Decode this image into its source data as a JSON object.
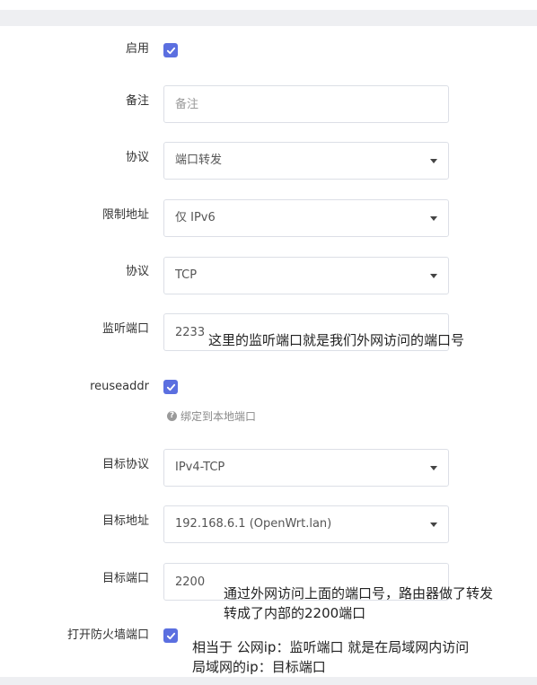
{
  "form": {
    "enable": {
      "label": "启用",
      "checked": true
    },
    "remark": {
      "label": "备注",
      "placeholder": "备注",
      "value": ""
    },
    "protocol": {
      "label": "协议",
      "value": "端口转发"
    },
    "restrict_address": {
      "label": "限制地址",
      "value": "仅 IPv6"
    },
    "protocol2": {
      "label": "协议",
      "value": "TCP"
    },
    "listen_port": {
      "label": "监听端口",
      "value": "2233"
    },
    "reuseaddr": {
      "label": "reuseaddr",
      "checked": true,
      "hint": "绑定到本地端口"
    },
    "target_protocol": {
      "label": "目标协议",
      "value": "IPv4-TCP"
    },
    "target_address": {
      "label": "目标地址",
      "value": "192.168.6.1 (OpenWrt.lan)"
    },
    "target_port": {
      "label": "目标端口",
      "value": "2200"
    },
    "open_firewall": {
      "label": "打开防火墙端口",
      "checked": true
    }
  },
  "annotations": {
    "note1": "这里的监听端口就是我们外网访问的端口号",
    "note2_line1": "通过外网访问上面的端口号，路由器做了转发",
    "note2_line2": "转成了内部的2200端口",
    "note3_line1": "相当于 公网ip：监听端口 就是在局域网内访问",
    "note3_line2": "局域网的ip：目标端口"
  },
  "colors": {
    "accent": "#5b6fe0",
    "band": "#eeeff2",
    "border": "#dcdfe6"
  }
}
